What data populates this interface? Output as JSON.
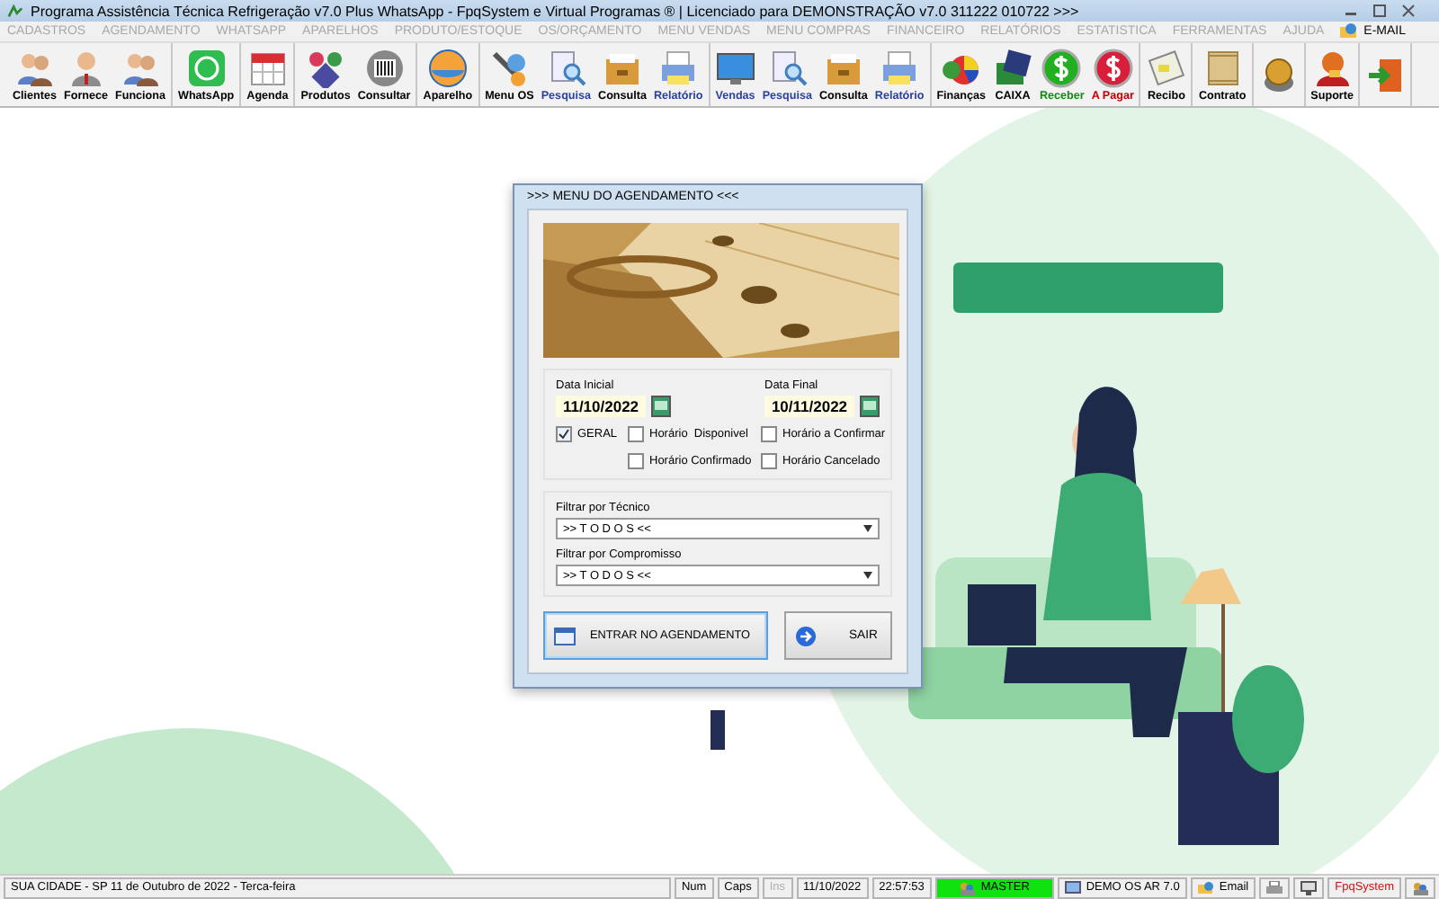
{
  "window": {
    "title": "Programa Assistência Técnica Refrigeração v7.0 Plus WhatsApp - FpqSystem e Virtual Programas ® | Licenciado para  DEMONSTRAÇÃO v7.0 311222 010722 >>>"
  },
  "menu": [
    {
      "label": "CADASTROS",
      "disabled": true
    },
    {
      "label": "AGENDAMENTO",
      "disabled": true
    },
    {
      "label": "WHATSAPP",
      "disabled": true
    },
    {
      "label": "APARELHOS",
      "disabled": true
    },
    {
      "label": "PRODUTO/ESTOQUE",
      "disabled": true
    },
    {
      "label": "OS/ORÇAMENTO",
      "disabled": true
    },
    {
      "label": "MENU VENDAS",
      "disabled": true
    },
    {
      "label": "MENU COMPRAS",
      "disabled": true
    },
    {
      "label": "FINANCEIRO",
      "disabled": true
    },
    {
      "label": "RELATÓRIOS",
      "disabled": true
    },
    {
      "label": "ESTATISTICA",
      "disabled": true
    },
    {
      "label": "FERRAMENTAS",
      "disabled": true
    },
    {
      "label": "AJUDA",
      "disabled": true
    },
    {
      "label": "E-MAIL",
      "disabled": false,
      "kind": "icon"
    }
  ],
  "toolbar": {
    "groups": [
      {
        "items": [
          {
            "kind": "people",
            "label": "Clientes",
            "color": "#000000"
          },
          {
            "kind": "person",
            "label": "Fornece",
            "color": "#000000"
          },
          {
            "kind": "people",
            "label": "Funciona",
            "color": "#000000"
          }
        ]
      },
      {
        "items": [
          {
            "kind": "chat",
            "label": "WhatsApp",
            "color": "#000000"
          }
        ]
      },
      {
        "items": [
          {
            "kind": "calendar",
            "label": "Agenda",
            "color": "#000000"
          }
        ]
      },
      {
        "items": [
          {
            "kind": "shapes",
            "label": "Produtos",
            "color": "#000000"
          },
          {
            "kind": "barcode",
            "label": "Consultar",
            "color": "#000000"
          }
        ]
      },
      {
        "items": [
          {
            "kind": "disc",
            "label": "Aparelho",
            "color": "#000000"
          }
        ]
      },
      {
        "items": [
          {
            "kind": "tools",
            "label": "Menu OS",
            "color": "#000000"
          },
          {
            "kind": "search",
            "label": "Pesquisa",
            "color": "#2a3fa0"
          },
          {
            "kind": "drawer",
            "label": "Consulta",
            "color": "#000000"
          },
          {
            "kind": "printer",
            "label": "Relatório",
            "color": "#2a3fa0"
          }
        ]
      },
      {
        "items": [
          {
            "kind": "monitor",
            "label": "Vendas",
            "color": "#2a3fa0"
          },
          {
            "kind": "search",
            "label": "Pesquisa",
            "color": "#2a3fa0"
          },
          {
            "kind": "drawer",
            "label": "Consulta",
            "color": "#000000"
          },
          {
            "kind": "printer",
            "label": "Relatório",
            "color": "#2a3fa0"
          }
        ]
      },
      {
        "items": [
          {
            "kind": "chart",
            "label": "Finanças",
            "color": "#000000"
          },
          {
            "kind": "book",
            "label": "CAIXA",
            "color": "#000000"
          },
          {
            "kind": "dollar-green",
            "label": "Receber",
            "color": "#138a13"
          },
          {
            "kind": "dollar-red",
            "label": "A Pagar",
            "color": "#c00000"
          }
        ]
      },
      {
        "items": [
          {
            "kind": "receipt",
            "label": "Recibo",
            "color": "#000000"
          }
        ]
      },
      {
        "items": [
          {
            "kind": "scroll",
            "label": "Contrato",
            "color": "#000000"
          }
        ]
      },
      {
        "items": [
          {
            "kind": "coin"
          }
        ]
      },
      {
        "items": [
          {
            "kind": "helper",
            "label": "Suporte",
            "color": "#000000"
          }
        ]
      },
      {
        "items": [
          {
            "kind": "exit"
          }
        ]
      }
    ]
  },
  "dialog": {
    "title": ">>> MENU DO AGENDAMENTO <<<",
    "start_date": {
      "label": "Data Inicial",
      "value": "11/10/2022"
    },
    "end_date": {
      "label": "Data Final",
      "value": "10/11/2022"
    },
    "checkboxes": [
      {
        "label": "GERAL",
        "checked": true
      },
      {
        "label": "Horário  Disponivel",
        "checked": false
      },
      {
        "label": "Horário a Confirmar",
        "checked": false
      },
      {
        "label": "Horário Confirmado",
        "checked": false
      },
      {
        "label": "Horário Cancelado",
        "checked": false
      }
    ],
    "filters": [
      {
        "label": "Filtrar por Técnico",
        "value": ">> T O D O S <<"
      },
      {
        "label": "Filtrar por Compromisso",
        "value": ">> T O D O S <<"
      }
    ],
    "buttons": [
      {
        "kind": "enter",
        "label": "ENTRAR NO AGENDAMENTO",
        "focused": true
      },
      {
        "kind": "exit",
        "label": "SAIR",
        "focused": false
      }
    ]
  },
  "status_bar": [
    {
      "kind": "wide",
      "text": "SUA CIDADE - SP 11 de Outubro de 2022 - Terca-feira"
    },
    {
      "kind": "text",
      "text": "Num"
    },
    {
      "kind": "text",
      "text": "Caps"
    },
    {
      "kind": "dim",
      "text": "Ins"
    },
    {
      "kind": "text",
      "text": "11/10/2022"
    },
    {
      "kind": "text",
      "text": "22:57:53"
    },
    {
      "kind": "master",
      "text": "MASTER"
    },
    {
      "kind": "icon-text",
      "text": "DEMO OS AR 7.0"
    },
    {
      "kind": "icon-text",
      "text": "Email"
    },
    {
      "kind": "printer"
    },
    {
      "kind": "monitor"
    },
    {
      "kind": "red",
      "text": "FpqSystem"
    },
    {
      "kind": "users"
    }
  ]
}
